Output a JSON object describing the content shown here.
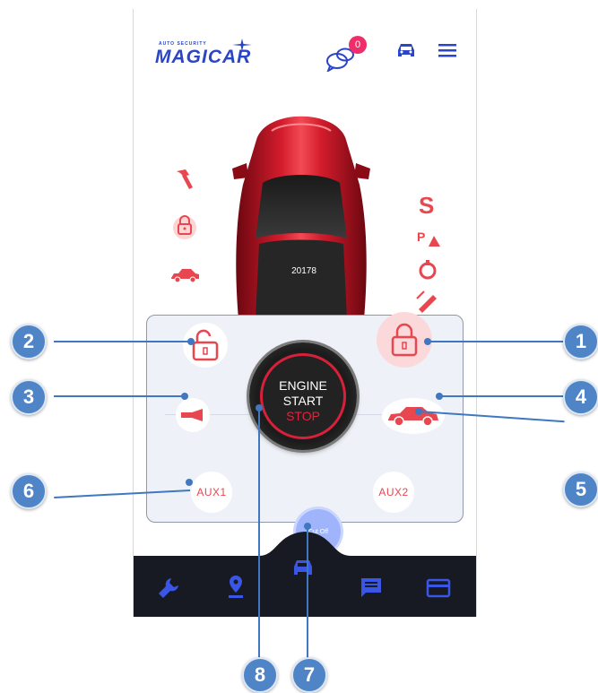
{
  "header": {
    "logo_tag": "AUTO SECURITY",
    "logo_name": "MAGICAR",
    "badge_count": "0"
  },
  "car": {
    "plate": "20178"
  },
  "status": {
    "right_top_letter": "S"
  },
  "controls": {
    "aux1_label": "AUX1",
    "aux2_label": "AUX2",
    "cutoff_label": "Cut Off",
    "engine": {
      "line1": "ENGINE",
      "line2": "START",
      "line3": "STOP"
    }
  },
  "markers": [
    "1",
    "2",
    "3",
    "4",
    "5",
    "6",
    "7",
    "8"
  ],
  "colors": {
    "brand_blue": "#2a45c8",
    "accent_red": "#e8474f",
    "marker_blue": "#4f84c6",
    "nav_dark": "#181a23",
    "badge_pink": "#ef2d6a",
    "cutoff_blue": "#9fb4fa"
  }
}
